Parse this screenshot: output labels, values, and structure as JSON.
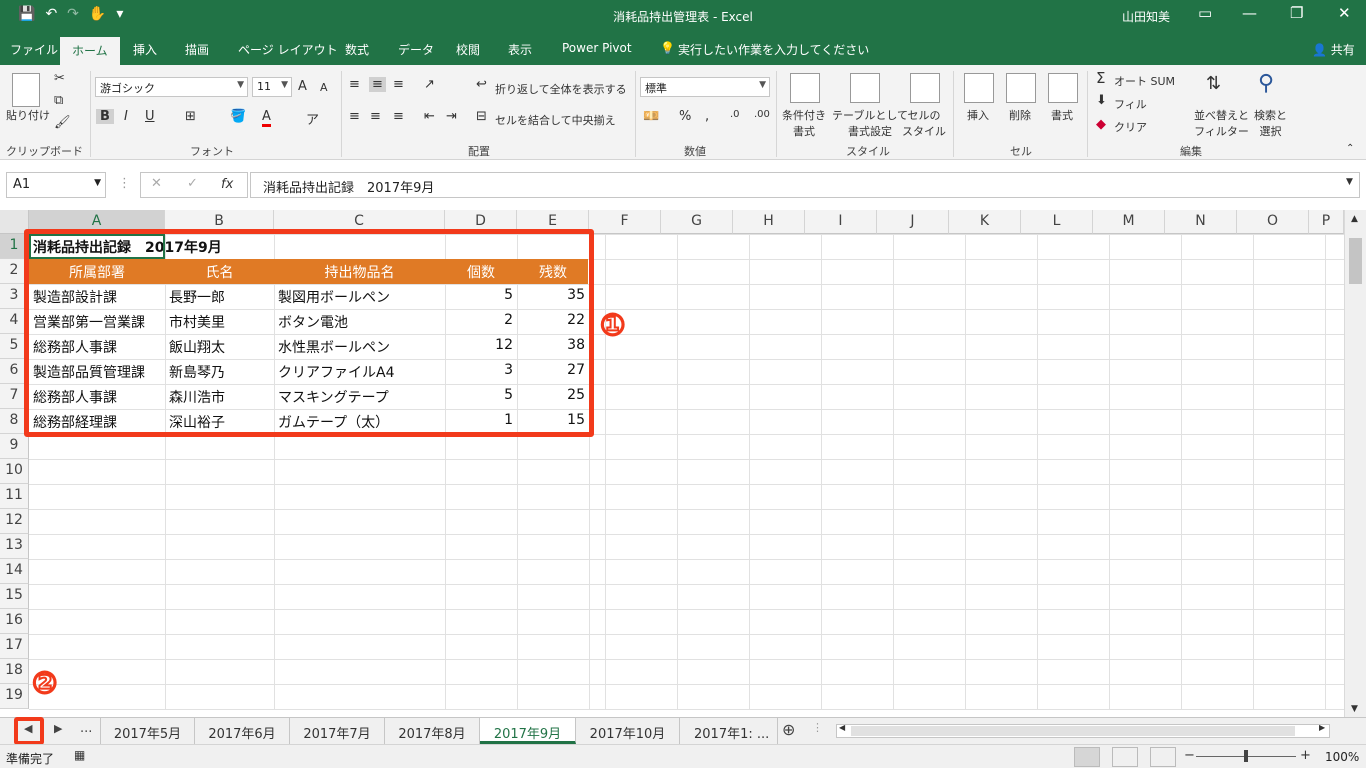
{
  "window": {
    "title": "消耗品持出管理表 - Excel",
    "user": "山田知美",
    "qat": [
      "💾",
      "↶",
      "↷",
      "✋",
      "▾"
    ],
    "controls": [
      "▭",
      "—",
      "❐",
      "✕"
    ]
  },
  "ribbon_tabs": [
    "ファイル",
    "ホーム",
    "挿入",
    "描画",
    "ページ レイアウト",
    "数式",
    "データ",
    "校閲",
    "表示",
    "Power Pivot",
    "実行したい作業を入力してください"
  ],
  "share_label": "共有",
  "ribbon": {
    "clipboard": {
      "paste": "貼り付け",
      "label": "クリップボード"
    },
    "font": {
      "name": "游ゴシック",
      "size": "11",
      "label": "フォント",
      "bold": "B",
      "italic": "I",
      "underline": "U",
      "grow": "A",
      "shrink": "A"
    },
    "alignment": {
      "wrap": "折り返して全体を表示する",
      "merge": "セルを結合して中央揃え",
      "label": "配置"
    },
    "number": {
      "format": "標準",
      "percent": "%",
      "comma": ",",
      "label": "数値"
    },
    "styles": {
      "conditional": "条件付き\n書式",
      "table": "テーブルとして\n書式設定",
      "cell": "セルの\nスタイル",
      "label": "スタイル"
    },
    "cells": {
      "insert": "挿入",
      "delete": "削除",
      "format": "書式",
      "label": "セル"
    },
    "editing": {
      "autosum": "オート SUM",
      "fill": "フィル",
      "clear": "クリア",
      "sort": "並べ替えと\nフィルター",
      "find": "検索と\n選択",
      "label": "編集"
    }
  },
  "formula_bar": {
    "name_box": "A1",
    "fx": "fx",
    "content": "消耗品持出記録　2017年9月"
  },
  "columns": [
    "A",
    "B",
    "C",
    "D",
    "E",
    "F",
    "G",
    "H",
    "I",
    "J",
    "K",
    "L",
    "M",
    "N",
    "O",
    "P"
  ],
  "rows": [
    "1",
    "2",
    "3",
    "4",
    "5",
    "6",
    "7",
    "8",
    "9",
    "10",
    "11",
    "12",
    "13",
    "14",
    "15",
    "16",
    "17",
    "18",
    "19"
  ],
  "sheet": {
    "title": "消耗品持出記録　2017年9月",
    "headers": [
      "所属部署",
      "氏名",
      "持出物品名",
      "個数",
      "残数"
    ],
    "records": [
      [
        "製造部設計課",
        "長野一郎",
        "製図用ボールペン",
        "5",
        "35"
      ],
      [
        "営業部第一営業課",
        "市村美里",
        "ボタン電池",
        "2",
        "22"
      ],
      [
        "総務部人事課",
        "飯山翔太",
        "水性黒ボールペン",
        "12",
        "38"
      ],
      [
        "製造部品質管理課",
        "新島琴乃",
        "クリアファイルA4",
        "3",
        "27"
      ],
      [
        "総務部人事課",
        "森川浩市",
        "マスキングテープ",
        "5",
        "25"
      ],
      [
        "総務部経理課",
        "深山裕子",
        "ガムテープ（太）",
        "1",
        "15"
      ]
    ]
  },
  "annotations": [
    "①",
    "②"
  ],
  "sheet_tabs": {
    "ellipsis": "...",
    "tabs": [
      "2017年5月",
      "2017年6月",
      "2017年7月",
      "2017年8月",
      "2017年9月",
      "2017年10月",
      "2017年1: ..."
    ],
    "active": "2017年9月",
    "add": "⊕"
  },
  "status": {
    "text": "準備完了",
    "zoom": "100%"
  },
  "colors": {
    "excel_green": "#217346",
    "header_orange": "#e07a25",
    "annotation_red": "#f23a1b"
  }
}
